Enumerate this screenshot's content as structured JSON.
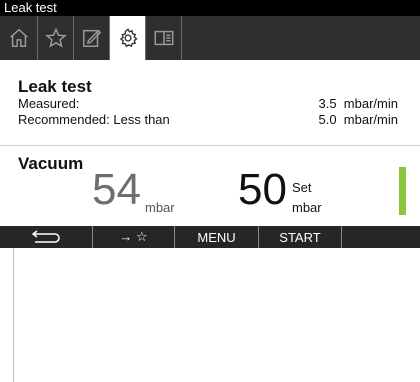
{
  "window": {
    "title": "Leak test"
  },
  "tabs": [
    {
      "name": "home-tab",
      "icon": "home-icon"
    },
    {
      "name": "favorites-tab",
      "icon": "star-icon"
    },
    {
      "name": "edit-tab",
      "icon": "edit-icon"
    },
    {
      "name": "settings-tab",
      "icon": "gear-icon",
      "active": true
    },
    {
      "name": "book-tab",
      "icon": "book-icon"
    }
  ],
  "leak_test": {
    "heading": "Leak test",
    "measured_label": "Measured:",
    "measured_value": "3.5  mbar/min",
    "recommended_label": "Recommended: Less than",
    "recommended_value": "5.0  mbar/min"
  },
  "vacuum": {
    "heading": "Vacuum",
    "measured_value": "54",
    "measured_unit": "mbar",
    "set_value": "50",
    "set_label": "Set",
    "set_unit": "mbar",
    "indicator_color": "#8cc63f"
  },
  "bottom_bar": {
    "back_icon": "back-arrow-icon",
    "add_favorite": "→ ☆",
    "menu": "MENU",
    "start": "START"
  }
}
